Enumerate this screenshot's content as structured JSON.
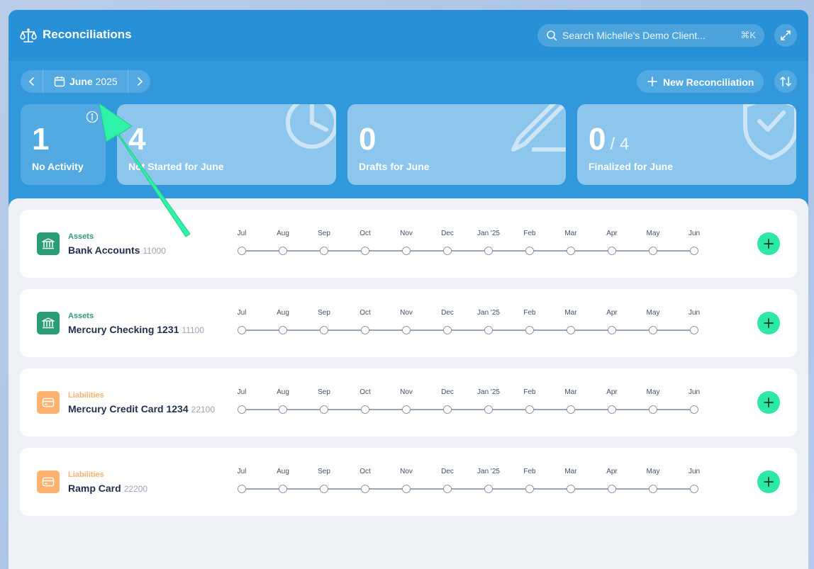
{
  "app": {
    "title": "Reconciliations",
    "search_placeholder": "Search Michelle's Demo Client...",
    "search_shortcut": "⌘K",
    "title_icon": "scale-icon",
    "expand_icon": "expand-icon"
  },
  "toolbar": {
    "month_label": "June",
    "year_label": "2025",
    "new_reconciliation_label": "New Reconciliation",
    "sort_icon": "sort-icon"
  },
  "stats": [
    {
      "value": "1",
      "caption": "No Activity"
    },
    {
      "value": "4",
      "caption": "Not Started for June"
    },
    {
      "value": "0",
      "caption": "Drafts for June"
    },
    {
      "value": "0",
      "denominator": "/ 4",
      "caption": "Finalized for June"
    }
  ],
  "timeline_months": [
    "Jul",
    "Aug",
    "Sep",
    "Oct",
    "Nov",
    "Dec",
    "Jan '25",
    "Feb",
    "Mar",
    "Apr",
    "May",
    "Jun"
  ],
  "accounts": [
    {
      "category": "Assets",
      "name": "Bank Accounts",
      "number": "11000",
      "icon": "bank-icon"
    },
    {
      "category": "Assets",
      "name": "Mercury Checking 1231",
      "number": "11100",
      "icon": "bank-icon"
    },
    {
      "category": "Liabilities",
      "name": "Mercury Credit Card 1234",
      "number": "22100",
      "icon": "credit-card-icon"
    },
    {
      "category": "Liabilities",
      "name": "Ramp Card",
      "number": "22200",
      "icon": "credit-card-icon"
    }
  ],
  "colors": {
    "header": "#2790d6",
    "hero": "#3198dc",
    "assets": "#2a9d75",
    "liabilities": "#ffb16f",
    "add_button": "#2ee8a5",
    "annotation_arrow": "#2ef2a8"
  }
}
